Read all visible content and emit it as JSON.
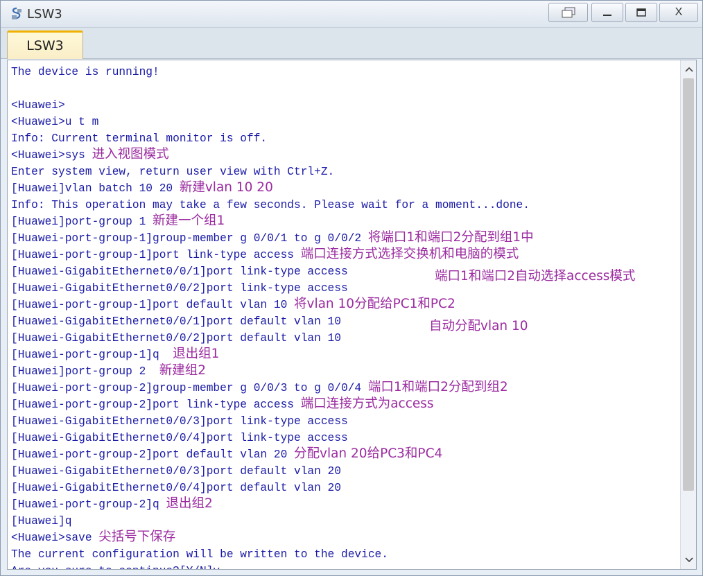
{
  "window": {
    "title": "LSW3"
  },
  "tab": {
    "label": "LSW3"
  },
  "controls": {
    "restore": "restore-icon",
    "minimize": "_",
    "maximize": "maximize-icon",
    "close": "X"
  },
  "colors": {
    "command_text": "#1a1aa6",
    "annotation_text": "#9b2ba0"
  },
  "terminal": {
    "lines": [
      {
        "cmd": "The device is running!",
        "note": ""
      },
      {
        "cmd": "",
        "note": ""
      },
      {
        "cmd": "<Huawei>",
        "note": ""
      },
      {
        "cmd": "<Huawei>u t m",
        "note": ""
      },
      {
        "cmd": "Info: Current terminal monitor is off.",
        "note": ""
      },
      {
        "cmd": "<Huawei>sys ",
        "note": "进入视图模式"
      },
      {
        "cmd": "Enter system view, return user view with Ctrl+Z.",
        "note": ""
      },
      {
        "cmd": "[Huawei]vlan batch 10 20 ",
        "note": "新建vlan 10 20"
      },
      {
        "cmd": "Info: This operation may take a few seconds. Please wait for a moment...done.",
        "note": ""
      },
      {
        "cmd": "[Huawei]port-group 1 ",
        "note": "新建一个组1"
      },
      {
        "cmd": "[Huawei-port-group-1]group-member g 0/0/1 to g 0/0/2 ",
        "note": "将端口1和端口2分配到组1中"
      },
      {
        "cmd": "[Huawei-port-group-1]port link-type access ",
        "note": "端口连接方式选择交换机和电脑的模式"
      },
      {
        "cmd": "[Huawei-GigabitEthernet0/0/1]port link-type access",
        "note": ""
      },
      {
        "cmd": "[Huawei-GigabitEthernet0/0/2]port link-type access",
        "note": ""
      },
      {
        "cmd": "[Huawei-port-group-1]port default vlan 10 ",
        "note": "将vlan 10分配给PC1和PC2"
      },
      {
        "cmd": "[Huawei-GigabitEthernet0/0/1]port default vlan 10",
        "note": ""
      },
      {
        "cmd": "[Huawei-GigabitEthernet0/0/2]port default vlan 10",
        "note": ""
      },
      {
        "cmd": "[Huawei-port-group-1]q  ",
        "note": "退出组1"
      },
      {
        "cmd": "[Huawei]port-group 2  ",
        "note": "新建组2"
      },
      {
        "cmd": "[Huawei-port-group-2]group-member g 0/0/3 to g 0/0/4 ",
        "note": "端口1和端口2分配到组2"
      },
      {
        "cmd": "[Huawei-port-group-2]port link-type access ",
        "note": "端口连接方式为access"
      },
      {
        "cmd": "[Huawei-GigabitEthernet0/0/3]port link-type access",
        "note": ""
      },
      {
        "cmd": "[Huawei-GigabitEthernet0/0/4]port link-type access",
        "note": ""
      },
      {
        "cmd": "[Huawei-port-group-2]port default vlan 20 ",
        "note": "分配vlan 20给PC3和PC4"
      },
      {
        "cmd": "[Huawei-GigabitEthernet0/0/3]port default vlan 20",
        "note": ""
      },
      {
        "cmd": "[Huawei-GigabitEthernet0/0/4]port default vlan 20",
        "note": ""
      },
      {
        "cmd": "[Huawei-port-group-2]q ",
        "note": "退出组2"
      },
      {
        "cmd": "[Huawei]q",
        "note": ""
      },
      {
        "cmd": "<Huawei>save ",
        "note": "尖括号下保存"
      },
      {
        "cmd": "The current configuration will be written to the device.",
        "note": ""
      },
      {
        "cmd": "Are you sure to continue?[Y/N]y",
        "note": ""
      }
    ],
    "side_notes": [
      {
        "text": "端口1和端口2自动选择access模式"
      },
      {
        "text": "自动分配vlan 10"
      }
    ]
  }
}
